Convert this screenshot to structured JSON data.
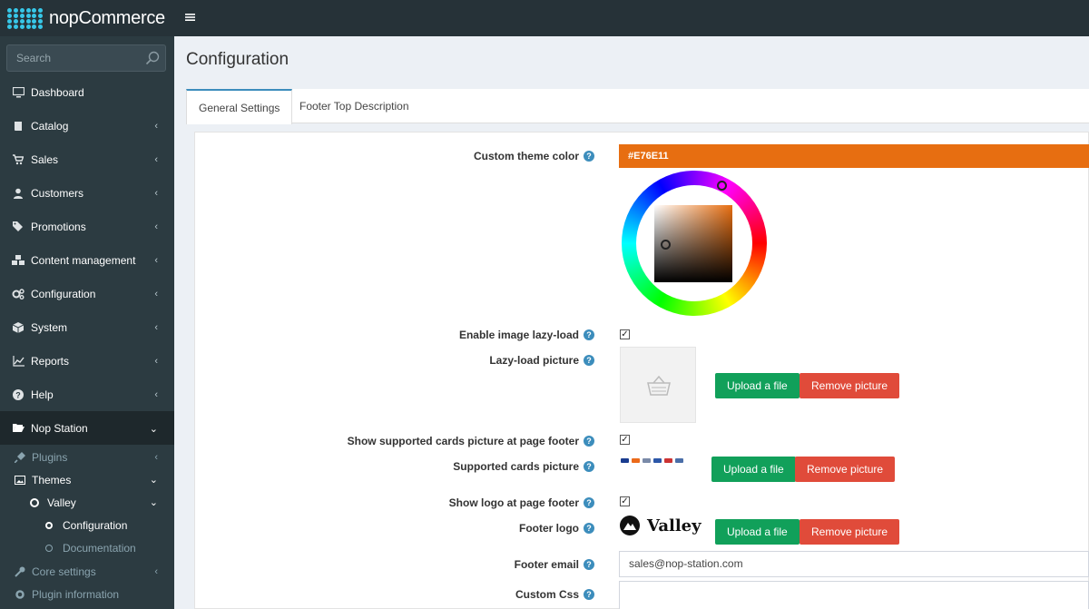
{
  "brand": {
    "name": "nopCommerce"
  },
  "search": {
    "placeholder": "Search"
  },
  "nav": [
    {
      "label": "Dashboard",
      "icon": "monitor-icon"
    },
    {
      "label": "Catalog",
      "icon": "book-icon"
    },
    {
      "label": "Sales",
      "icon": "cart-icon"
    },
    {
      "label": "Customers",
      "icon": "user-icon"
    },
    {
      "label": "Promotions",
      "icon": "tags-icon"
    },
    {
      "label": "Content management",
      "icon": "cubes-icon"
    },
    {
      "label": "Configuration",
      "icon": "gears-icon"
    },
    {
      "label": "System",
      "icon": "cube-icon"
    },
    {
      "label": "Reports",
      "icon": "line-chart-icon"
    },
    {
      "label": "Help",
      "icon": "question-icon"
    },
    {
      "label": "Nop Station",
      "icon": "folder-open-icon"
    }
  ],
  "subnav": [
    {
      "label": "Plugins",
      "icon": "plug-icon"
    },
    {
      "label": "Themes",
      "icon": "image-icon"
    },
    {
      "label": "Valley",
      "icon": "circle-icon"
    },
    {
      "label": "Configuration",
      "icon": "circle-icon"
    },
    {
      "label": "Documentation",
      "icon": "circle-icon"
    },
    {
      "label": "Core settings",
      "icon": "wrench-icon"
    },
    {
      "label": "Plugin information",
      "icon": "gear-icon"
    }
  ],
  "page": {
    "title": "Configuration"
  },
  "tabs": [
    {
      "label": "General Settings"
    },
    {
      "label": "Footer Top Description"
    }
  ],
  "form": {
    "custom_theme_color": {
      "label": "Custom theme color",
      "value": "#E76E11"
    },
    "enable_lazy_load": {
      "label": "Enable image lazy-load",
      "checked": true
    },
    "lazy_load_picture": {
      "label": "Lazy-load picture"
    },
    "show_cards": {
      "label": "Show supported cards picture at page footer",
      "checked": true
    },
    "supported_cards_picture": {
      "label": "Supported cards picture"
    },
    "show_logo": {
      "label": "Show logo at page footer",
      "checked": true
    },
    "footer_logo": {
      "label": "Footer logo",
      "logo_text": "Valley"
    },
    "footer_email": {
      "label": "Footer email",
      "value": "sales@nop-station.com"
    },
    "custom_css": {
      "label": "Custom Css"
    },
    "upload_label": "Upload a file",
    "remove_label": "Remove picture"
  },
  "colors": {
    "theme": "#E76E11",
    "topbar": "#263238",
    "sidebar": "#2c3b41",
    "upload": "#11a05a",
    "remove": "#e04b3a",
    "help": "#3c8dbc"
  }
}
